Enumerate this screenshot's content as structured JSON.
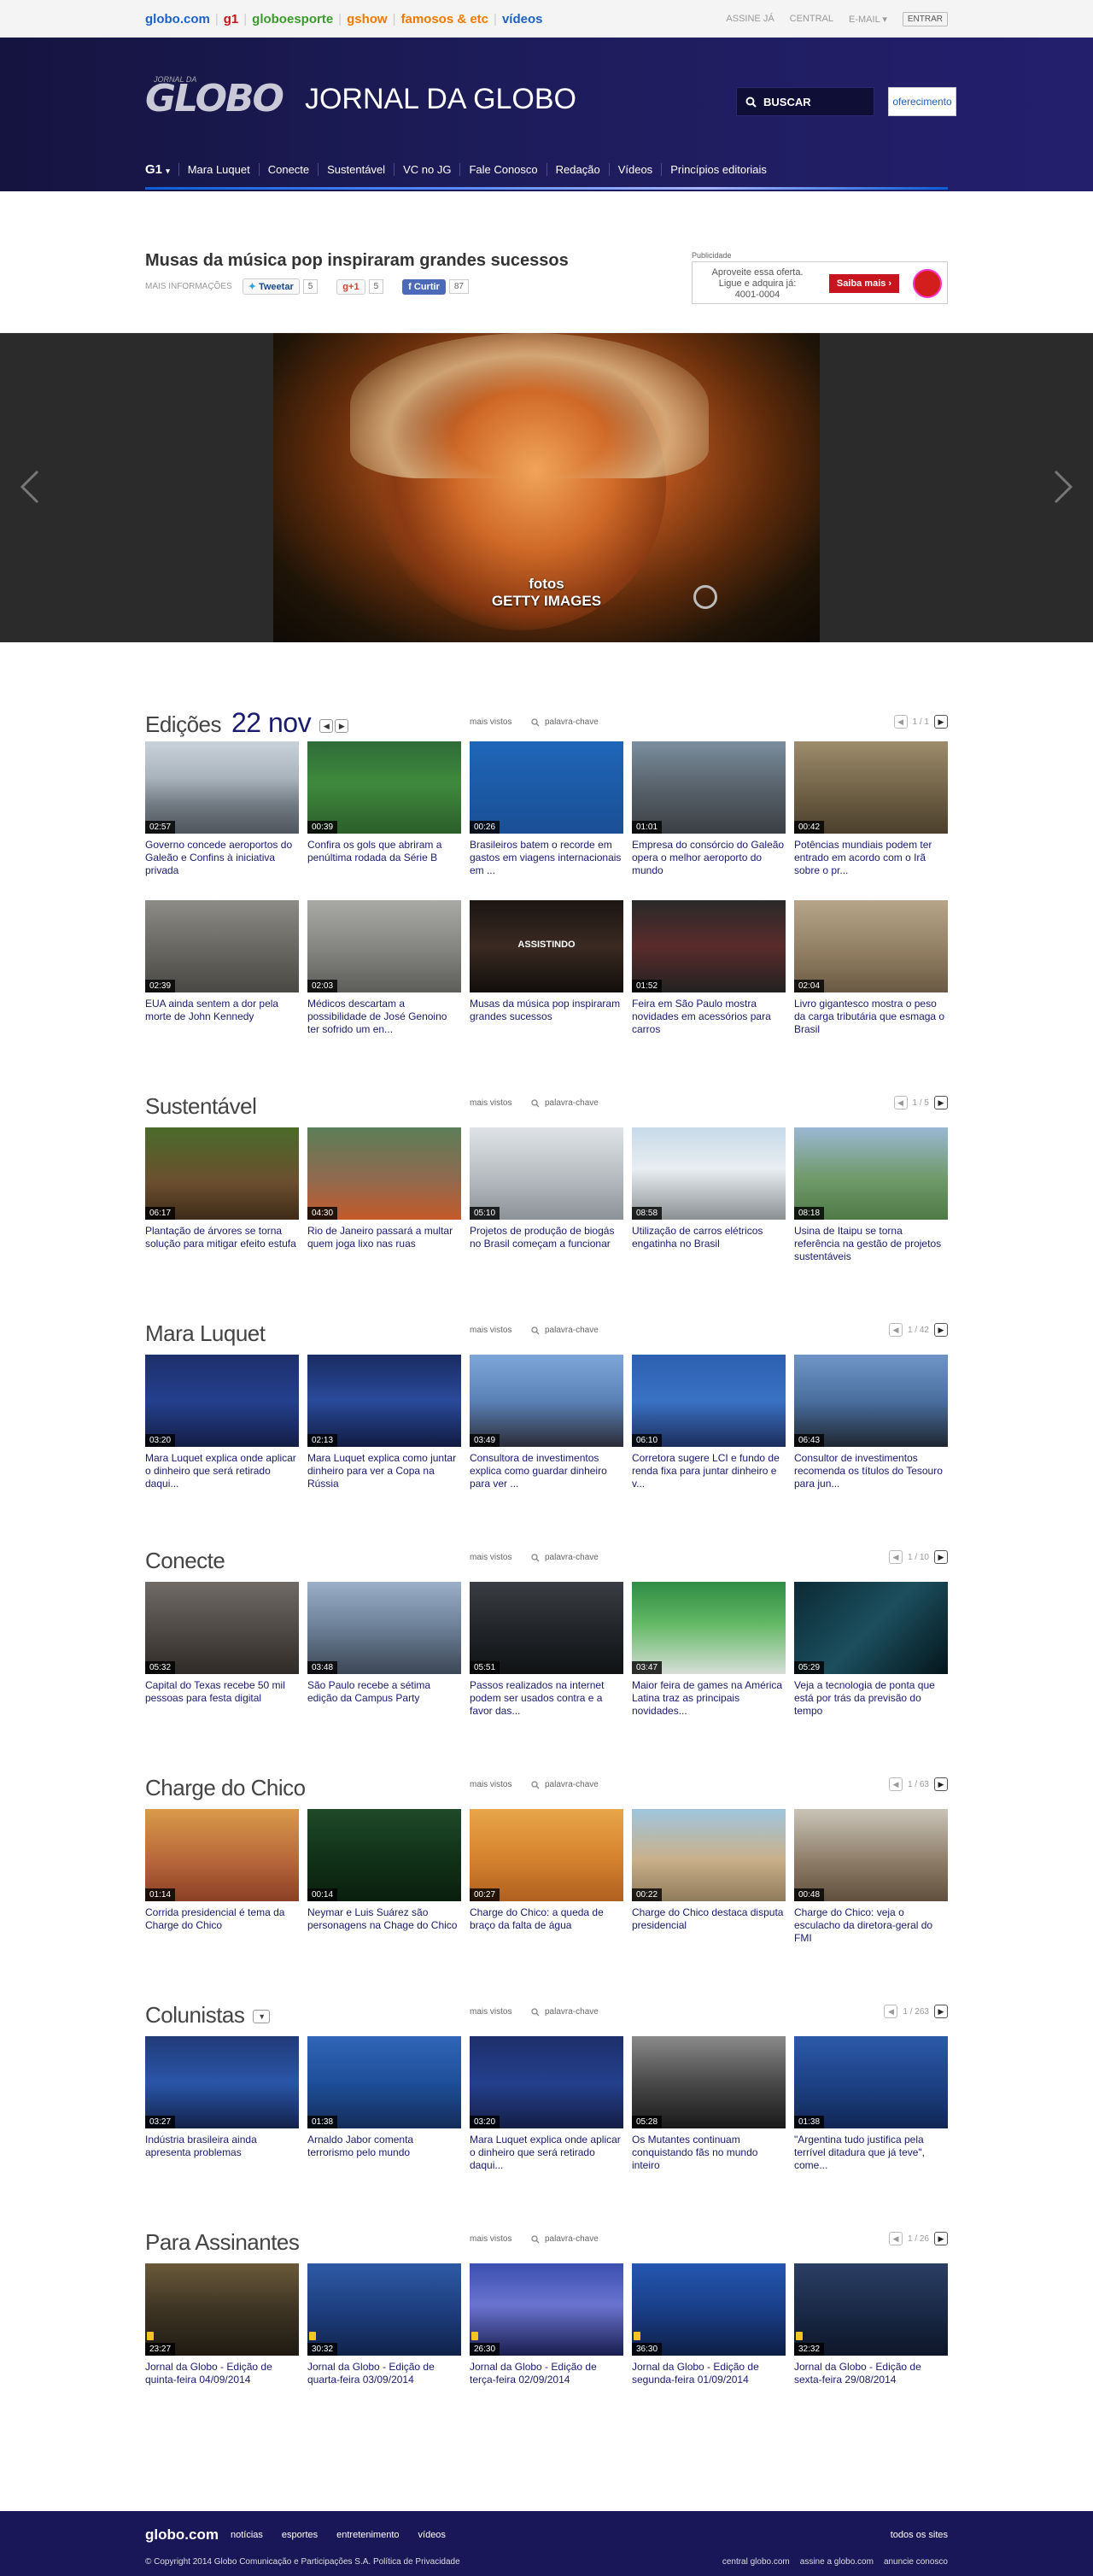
{
  "topbar": {
    "brands": [
      {
        "label": "globo.com",
        "color": "#1d62c7"
      },
      {
        "label": "g1",
        "color": "#c0141b"
      },
      {
        "label": "globoesporte",
        "color": "#3b9a2c"
      },
      {
        "label": "gshow",
        "color": "#f07a00"
      },
      {
        "label": "famosos & etc",
        "color": "#f07a00"
      },
      {
        "label": "vídeos",
        "color": "#1d62c7"
      }
    ],
    "links": [
      "ASSINE JÁ",
      "CENTRAL",
      "E-MAIL",
      "ENTRAR"
    ]
  },
  "header": {
    "logo_small": "JORNAL DA",
    "logo_main": "GLOBO",
    "title": "JORNAL DA GLOBO",
    "search_label": "BUSCAR",
    "sponsor_label": "oferecimento",
    "menu_g1": "G1",
    "menu": [
      "Mara Luquet",
      "Conecte",
      "Sustentável",
      "VC no JG",
      "Fale Conosco",
      "Redação",
      "Vídeos",
      "Princípios editoriais"
    ]
  },
  "headline": {
    "title": "Musas da música pop inspiraram grandes sucessos",
    "info_label": "MAIS INFORMAÇÕES",
    "tweet_label": "Tweetar",
    "tweet_count": "5",
    "gplus_label": "+1",
    "gplus_count": "5",
    "like_label": "Curtir",
    "like_count": "87",
    "ad_label": "Publicidade",
    "ad_text": "Aproveite essa oferta. Ligue e adquira já: 4001-0004",
    "ad_button": "Saiba mais ›"
  },
  "hero": {
    "caption_line1": "fotos",
    "caption_line2": "GETTY IMAGES"
  },
  "sections": [
    {
      "title": "Edições",
      "date": "22 nov",
      "mv": "mais vistos",
      "kw": "palavra-chave",
      "page": "1 / 1",
      "cards": [
        {
          "dur": "02:57",
          "title": "Governo concede aeroportos do Galeão e Confins à iniciativa privada",
          "bg": "linear-gradient(180deg,#c9d2da 0%,#a9b3bc 40%,#6f7780 70%,#4e555c 100%)"
        },
        {
          "dur": "00:39",
          "title": "Confira os gols que abriram a penúltima rodada da Série B",
          "bg": "linear-gradient(180deg,#2f6b38 0%,#3f8a3d 45%,#2b5e2a 100%)"
        },
        {
          "dur": "00:26",
          "title": "Brasileiros batem o recorde em gastos em viagens internacionais em ...",
          "bg": "linear-gradient(180deg,#1f66b8 0%,#1a4f95 100%)"
        },
        {
          "dur": "01:01",
          "title": "Empresa do consórcio do Galeão opera o melhor aeroporto do mundo",
          "bg": "linear-gradient(180deg,#7b8f9e 0%,#58626b 50%,#3b3f44 100%)"
        },
        {
          "dur": "00:42",
          "title": "Potências mundiais podem ter entrado em acordo com o Irã sobre o pr...",
          "bg": "linear-gradient(180deg,#9c8c6b 0%,#6c5e44 60%,#4b3f2c 100%)"
        },
        {
          "dur": "02:39",
          "title": "EUA ainda sentem a dor pela morte de John Kennedy",
          "bg": "linear-gradient(180deg,#8d8b86 0%,#6b6964 50%,#4a4844 100%)"
        },
        {
          "dur": "02:03",
          "title": "Médicos descartam a possibilidade de José Genoino ter sofrido um en...",
          "bg": "linear-gradient(180deg,#a9a9a6 0%,#868683 50%,#5d5d5a 100%)"
        },
        {
          "dur": "",
          "title": "Musas da música pop inspiraram grandes sucessos",
          "bg": "linear-gradient(180deg,#1b1512 0%,#3a2a22 50%,#120e0b 100%)",
          "assist": "ASSISTINDO"
        },
        {
          "dur": "01:52",
          "title": "Feira em São Paulo mostra novidades em acessórios para carros",
          "bg": "linear-gradient(180deg,#2a2a2a 0%,#5a2b2b 50%,#222 100%)"
        },
        {
          "dur": "02:04",
          "title": "Livro gigantesco mostra o peso da carga tributária que esmaga o Brasil",
          "bg": "linear-gradient(180deg,#b7a58a 0%,#8e7b60 60%,#6a5a44 100%)"
        }
      ]
    },
    {
      "title": "Sustentável",
      "mv": "mais vistos",
      "kw": "palavra-chave",
      "page": "1 / 5",
      "cards": [
        {
          "dur": "06:17",
          "title": "Plantação de árvores se torna solução para mitigar efeito estufa",
          "bg": "linear-gradient(180deg,#4a6b2a 0%,#6b4e2f 60%,#3d2b18 100%)"
        },
        {
          "dur": "04:30",
          "title": "Rio de Janeiro passará a multar quem joga lixo nas ruas",
          "bg": "linear-gradient(180deg,#5b7e58 0%,#8f6a4f 55%,#c35a2a 100%)"
        },
        {
          "dur": "05:10",
          "title": "Projetos de produção de biogás no Brasil começam a funcionar",
          "bg": "linear-gradient(180deg,#dfe3e6 0%,#b9bfc3 50%,#8b9196 100%)"
        },
        {
          "dur": "08:58",
          "title": "Utilização de carros elétricos engatinha no Brasil",
          "bg": "linear-gradient(180deg,#c7d9e8 0%,#e8eef2 45%,#8a8f92 100%)"
        },
        {
          "dur": "08:18",
          "title": "Usina de Itaipu se torna referência na gestão de projetos sustentáveis",
          "bg": "linear-gradient(180deg,#9bb8d4 0%,#6f9a6a 55%,#4e7a46 100%)"
        }
      ]
    },
    {
      "title": "Mara Luquet",
      "mv": "mais vistos",
      "kw": "palavra-chave",
      "page": "1 / 42",
      "cards": [
        {
          "dur": "03:20",
          "title": "Mara Luquet explica onde aplicar o dinheiro que será retirado daqui...",
          "bg": "linear-gradient(180deg,#1e2f6b 0%,#24408d 50%,#141e45 100%)"
        },
        {
          "dur": "02:13",
          "title": "Mara Luquet explica como juntar dinheiro para ver a Copa na Rússia",
          "bg": "linear-gradient(180deg,#1a2c62 0%,#2a4a9a 50%,#111b40 100%)"
        },
        {
          "dur": "03:49",
          "title": "Consultora de investimentos explica como guardar dinheiro para ver ...",
          "bg": "linear-gradient(180deg,#7ea6d8 0%,#5b82b8 50%,#2b2b35 100%)"
        },
        {
          "dur": "06:10",
          "title": "Corretora sugere LCI e fundo de renda fixa para juntar dinheiro e v...",
          "bg": "linear-gradient(180deg,#2c5fb0 0%,#3a72c4 50%,#1c2d5b 100%)"
        },
        {
          "dur": "06:43",
          "title": "Consultor de investimentos recomenda os títulos do Tesouro para jun...",
          "bg": "linear-gradient(180deg,#6f95c6 0%,#4a6f9f 50%,#1f2630 100%)"
        }
      ]
    },
    {
      "title": "Conecte",
      "mv": "mais vistos",
      "kw": "palavra-chave",
      "page": "1 / 10",
      "cards": [
        {
          "dur": "05:32",
          "title": "Capital do Texas recebe 50 mil pessoas para festa digital",
          "bg": "linear-gradient(180deg,#6f6a66 0%,#514b47 50%,#2e2a27 100%)"
        },
        {
          "dur": "03:48",
          "title": "São Paulo recebe a sétima edição da Campus Party",
          "bg": "linear-gradient(180deg,#9ab0c8 0%,#6b7f96 50%,#3c4654 100%)"
        },
        {
          "dur": "05:51",
          "title": "Passos realizados na internet podem ser usados contra e a favor das...",
          "bg": "linear-gradient(180deg,#3a3e43 0%,#22262a 50%,#101214 100%)"
        },
        {
          "dur": "03:47",
          "title": "Maior feira de games na América Latina traz as principais novidades...",
          "bg": "linear-gradient(180deg,#2f8d45 0%,#62b864 45%,#d7ded8 100%)"
        },
        {
          "dur": "05:29",
          "title": "Veja a tecnologia de ponta que está por trás da previsão do tempo",
          "bg": "linear-gradient(135deg,#0c2a35 0%,#1c4f5e 50%,#05151b 100%)"
        }
      ]
    },
    {
      "title": "Charge do Chico",
      "mv": "mais vistos",
      "kw": "palavra-chave",
      "page": "1 / 63",
      "cards": [
        {
          "dur": "01:14",
          "title": "Corrida presidencial é tema da Charge do Chico",
          "bg": "linear-gradient(180deg,#d99a4a 0%,#b8683b 55%,#8b3f25 100%)"
        },
        {
          "dur": "00:14",
          "title": "Neymar e Luis Suárez são personagens na Chage do Chico",
          "bg": "linear-gradient(180deg,#1f4a2a 0%,#123319 50%,#0a1f0e 100%)"
        },
        {
          "dur": "00:27",
          "title": "Charge do Chico: a queda de braço da falta de água",
          "bg": "linear-gradient(180deg,#e7a64a 0%,#d88530 50%,#b06020 100%)"
        },
        {
          "dur": "00:22",
          "title": "Charge do Chico destaca disputa presidencial",
          "bg": "linear-gradient(180deg,#9fc5dd 0%,#c9b08a 55%,#8f7a5a 100%)"
        },
        {
          "dur": "00:48",
          "title": "Charge do Chico: veja o esculacho da diretora-geral do FMI",
          "bg": "linear-gradient(180deg,#c9c4b8 0%,#8f7f6a 55%,#5f4f3c 100%)"
        }
      ]
    },
    {
      "title": "Colunistas",
      "dropdown": true,
      "mv": "mais vistos",
      "kw": "palavra-chave",
      "page": "1 / 263",
      "cards": [
        {
          "dur": "03:27",
          "title": "Indústria brasileira ainda apresenta problemas",
          "bg": "linear-gradient(180deg,#213a78 0%,#2a56a8 50%,#13224a 100%)"
        },
        {
          "dur": "01:38",
          "title": "Arnaldo Jabor comenta terrorismo pelo mundo",
          "bg": "linear-gradient(180deg,#3066b8 0%,#1e4f9a 50%,#142c58 100%)"
        },
        {
          "dur": "03:20",
          "title": "Mara Luquet explica onde aplicar o dinheiro que será retirado daqui...",
          "bg": "linear-gradient(180deg,#1e2f6b 0%,#24408d 50%,#141e45 100%)"
        },
        {
          "dur": "05:28",
          "title": "Os Mutantes continuam conquistando fãs no mundo inteiro",
          "bg": "linear-gradient(180deg,#8a8a8a 0%,#4a4a4a 50%,#1a1a1a 100%)"
        },
        {
          "dur": "01:38",
          "title": "\"Argentina tudo justifica pela terrível ditadura que já teve\", come...",
          "bg": "linear-gradient(180deg,#2c5aa8 0%,#1d4286 50%,#112654 100%)"
        }
      ]
    },
    {
      "title": "Para Assinantes",
      "mv": "mais vistos",
      "kw": "palavra-chave",
      "page": "1 / 26",
      "cards": [
        {
          "dur": "23:27",
          "title": "Jornal da Globo - Edição de quinta-feira 04/09/2014",
          "bg": "linear-gradient(180deg,#6a5a3a 0%,#3e3424 50%,#1e1a12 100%)",
          "lock": true
        },
        {
          "dur": "30:32",
          "title": "Jornal da Globo - Edição de quarta-feira 03/09/2014",
          "bg": "linear-gradient(180deg,#2d5aa5 0%,#1e3f80 50%,#10224a 100%)",
          "lock": true
        },
        {
          "dur": "26:30",
          "title": "Jornal da Globo - Edição de terça-feira 02/09/2014",
          "bg": "linear-gradient(180deg,#3c4fb0 0%,#6a74d0 45%,#1a1d4e 100%)",
          "lock": true
        },
        {
          "dur": "36:30",
          "title": "Jornal da Globo - Edição de segunda-feira 01/09/2014",
          "bg": "linear-gradient(180deg,#2456b0 0%,#1a3f88 50%,#0d1e45 100%)",
          "lock": true
        },
        {
          "dur": "32:32",
          "title": "Jornal da Globo - Edição de sexta-feira 29/08/2014",
          "bg": "linear-gradient(180deg,#2b3f64 0%,#1a2a48 50%,#0e1628 100%)",
          "lock": true
        }
      ]
    }
  ],
  "footer": {
    "logo": "globo.com",
    "nav": [
      "notícias",
      "esportes",
      "entretenimento",
      "vídeos"
    ],
    "all_sites": "todos os sites",
    "copyright": "© Copyright 2014 Globo Comunicação e Participações S.A. Política de Privacidade",
    "links": [
      "central globo.com",
      "assine a globo.com",
      "anuncie conosco"
    ]
  }
}
